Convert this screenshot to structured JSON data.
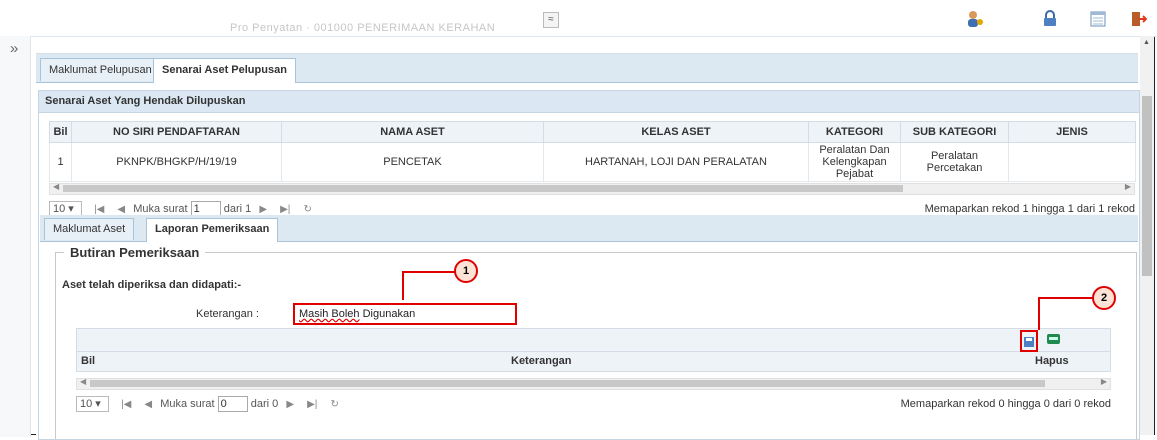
{
  "topbar": {
    "faded_title": "Pro Penyatan · 001000 PENERIMAAN KERAHAN",
    "collapse_glyph": "≈",
    "icons": [
      "user-icon",
      "lock-icon",
      "calendar-icon",
      "logout-icon"
    ]
  },
  "sidebar": {
    "expand_glyph": "»"
  },
  "tabs": [
    {
      "label": "Maklumat Pelupusan",
      "active": false
    },
    {
      "label": "Senarai Aset Pelupusan",
      "active": true
    }
  ],
  "asset_panel": {
    "title": "Senarai Aset Yang Hendak Dilupuskan",
    "columns": [
      "Bil",
      "NO SIRI PENDAFTARAN",
      "NAMA ASET",
      "KELAS ASET",
      "KATEGORI",
      "SUB KATEGORI",
      "JENIS"
    ],
    "rows": [
      {
        "bil": "1",
        "no_siri": "PKNPK/BHGKP/H/19/19",
        "nama": "PENCETAK",
        "kelas": "HARTANAH, LOJI DAN PERALATAN",
        "kategori_1": "Peralatan Dan",
        "kategori_2": "Kelengkapan Pejabat",
        "sub": "Peralatan Percetakan",
        "jenis": ""
      }
    ],
    "pager": {
      "page_size": "10",
      "page_label": "Muka surat",
      "page": "1",
      "of_label": "dari 1",
      "info": "Memaparkan rekod 1 hingga 1 dari 1 rekod"
    }
  },
  "subtabs": [
    {
      "label": "Maklumat Aset",
      "active": false
    },
    {
      "label": "Laporan Pemeriksaan",
      "active": true
    }
  ],
  "inspection": {
    "legend": "Butiran Pemeriksaan",
    "static_text": "Aset telah diperiksa dan didapati:-",
    "ket_label": "Keterangan :",
    "ket_value_wavy": "Masih Boleh",
    "ket_value_rest": " Digunakan",
    "columns": [
      "Bil",
      "Keterangan",
      "Hapus"
    ],
    "pager": {
      "page_size": "10",
      "page_label": "Muka surat",
      "page": "0",
      "of_label": "dari 0",
      "info": "Memaparkan rekod 0 hingga 0 dari 0 rekod"
    }
  },
  "callouts": [
    "1",
    "2"
  ],
  "colors": {
    "highlight": "#e00000",
    "header_bg": "#dbe8f3"
  }
}
